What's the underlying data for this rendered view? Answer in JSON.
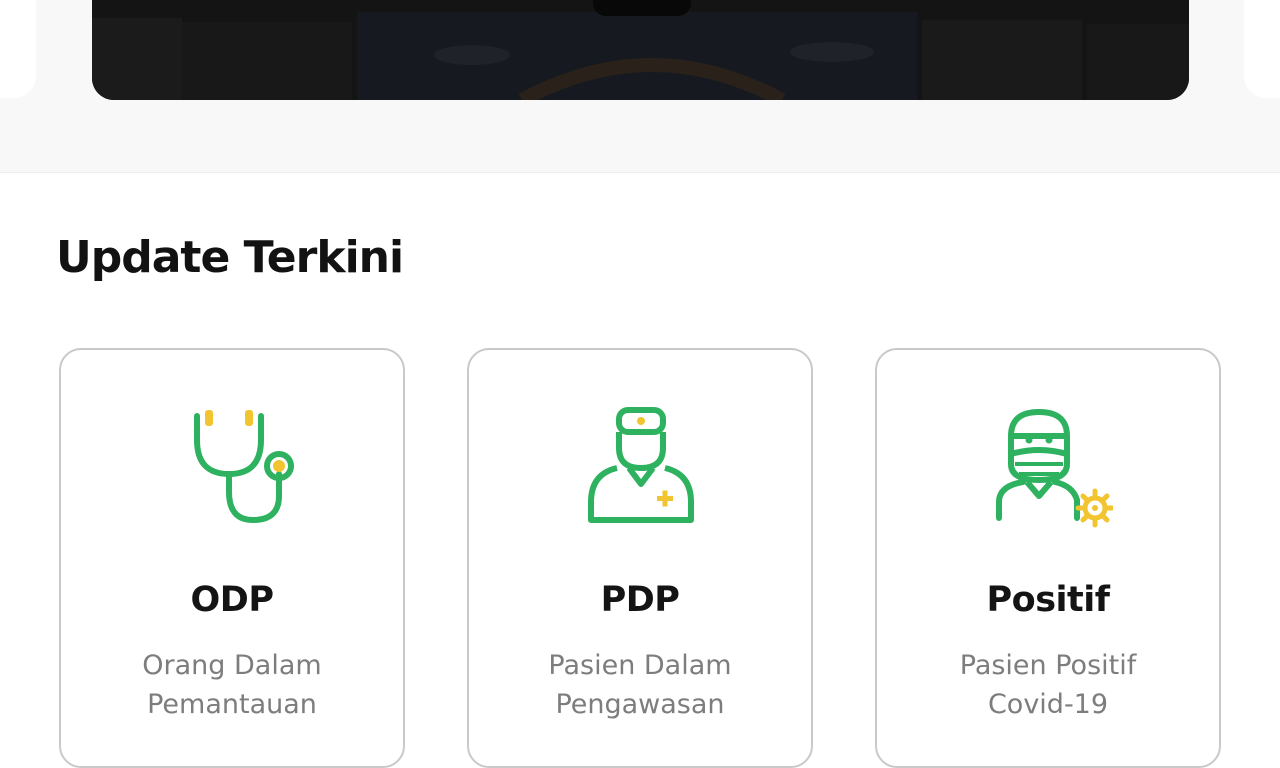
{
  "section": {
    "title": "Update Terkini"
  },
  "cards": [
    {
      "title": "ODP",
      "desc_line1": "Orang Dalam",
      "desc_line2": "Pemantauan",
      "icon": "stethoscope-icon"
    },
    {
      "title": "PDP",
      "desc_line1": "Pasien Dalam",
      "desc_line2": "Pengawasan",
      "icon": "doctor-icon"
    },
    {
      "title": "Positif",
      "desc_line1": "Pasien Positif",
      "desc_line2": "Covid-19",
      "icon": "masked-patient-virus-icon"
    }
  ],
  "colors": {
    "icon_green": "#2eb25f",
    "icon_yellow": "#f1c430",
    "title_text": "#141414",
    "muted_text": "#7d7d7d",
    "card_border": "#c9c9c9"
  }
}
